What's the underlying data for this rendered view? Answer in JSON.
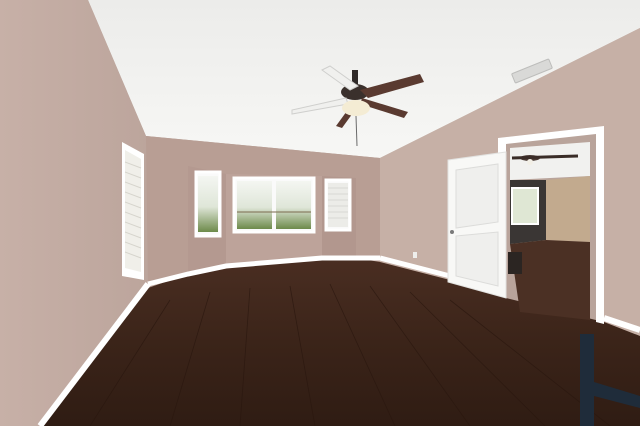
{
  "scene": {
    "kind": "empty-room-photo",
    "colors": {
      "ceiling": "#f4f4f2",
      "wall_left": "#c3aca3",
      "wall_back": "#b89e94",
      "wall_right": "#c6b0a6",
      "trim": "#ffffff",
      "floor": "#3b2419",
      "door": "#f8f8f6",
      "fan_blade": "#5a3a30"
    },
    "features": {
      "ceiling_fan": "ceiling-fan-with-light",
      "doorway": "open-door-to-adjacent-room",
      "windows": "bay-window-with-blinds",
      "flooring": "dark-hardwood"
    }
  }
}
